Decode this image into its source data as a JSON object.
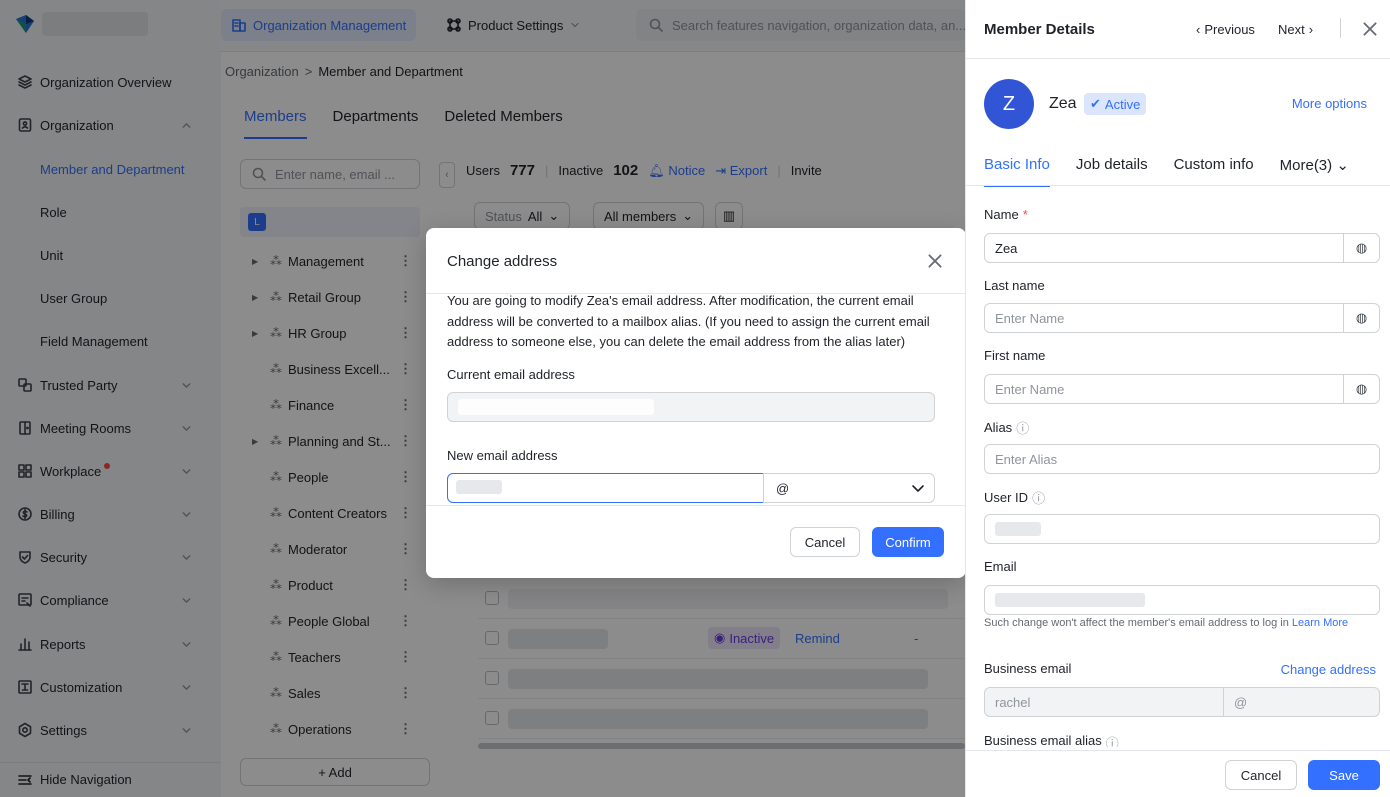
{
  "nav": {
    "items": [
      {
        "label": "Organization Overview",
        "icon": "layers-icon"
      },
      {
        "label": "Organization",
        "icon": "org-icon"
      },
      {
        "label": "Trusted Party",
        "icon": "trusted-party-icon"
      },
      {
        "label": "Meeting Rooms",
        "icon": "meeting-rooms-icon"
      },
      {
        "label": "Workplace",
        "icon": "workplace-icon"
      },
      {
        "label": "Billing",
        "icon": "billing-icon"
      },
      {
        "label": "Security",
        "icon": "shield-icon"
      },
      {
        "label": "Compliance",
        "icon": "compliance-icon"
      },
      {
        "label": "Reports",
        "icon": "reports-icon"
      },
      {
        "label": "Customization",
        "icon": "customization-icon"
      },
      {
        "label": "Settings",
        "icon": "gear-icon"
      }
    ],
    "sub_items": [
      "Member and Department",
      "Role",
      "Unit",
      "User Group",
      "Field Management"
    ],
    "hide_label": "Hide Navigation"
  },
  "topbar": {
    "org_mgmt": "Organization Management",
    "product_settings": "Product Settings",
    "search_placeholder": "Search features navigation, organization data, an..."
  },
  "breadcrumb": {
    "root": "Organization",
    "sep": ">",
    "current": "Member and Department"
  },
  "tabs": [
    "Members",
    "Departments",
    "Deleted Members"
  ],
  "tree": {
    "search_placeholder": "Enter name, email ...",
    "root_badge": "L",
    "items": [
      "Management",
      "Retail Group",
      "HR Group",
      "Business Excell...",
      "Finance",
      "Planning and St...",
      "People",
      "Content Creators",
      "Moderator",
      "Product",
      "People Global",
      "Teachers",
      "Sales",
      "Operations"
    ],
    "add_label": "+ Add"
  },
  "stats": {
    "users_label": "Users",
    "users_count": "777",
    "inactive_label": "Inactive",
    "inactive_count": "102",
    "notice": "Notice",
    "export": "Export",
    "invite": "Invite"
  },
  "filters": {
    "status_label": "Status",
    "status_value": "All",
    "members_value": "All members"
  },
  "table": {
    "inactive_badge": "Inactive",
    "remind": "Remind",
    "dash": "-"
  },
  "modal": {
    "title": "Change address",
    "description": "You are going to modify Zea's email address. After modification, the current email address will be converted to a mailbox alias. (If you need to assign the current email address to someone else, you can delete the email address from the alias later)",
    "current_label": "Current email address",
    "new_label": "New email address",
    "at": "@",
    "cancel": "Cancel",
    "confirm": "Confirm"
  },
  "panel": {
    "title": "Member Details",
    "previous": "Previous",
    "next": "Next",
    "avatar_letter": "Z",
    "name": "Zea",
    "status": "Active",
    "more_options": "More options",
    "tabs": [
      "Basic Info",
      "Job details",
      "Custom info",
      "More(3)"
    ],
    "name_label": "Name",
    "name_required": "*",
    "name_value": "Zea",
    "last_name_label": "Last name",
    "last_name_placeholder": "Enter Name",
    "first_name_label": "First name",
    "first_name_placeholder": "Enter Name",
    "alias_label": "Alias",
    "alias_placeholder": "Enter Alias",
    "user_id_label": "User ID",
    "email_label": "Email",
    "email_help": "Such change won't affect the member's email address to log in",
    "learn_more": "Learn More",
    "business_email_label": "Business email",
    "change_address": "Change address",
    "business_email_value": "rachel",
    "at": "@",
    "business_alias_label": "Business email alias",
    "cancel": "Cancel",
    "save": "Save"
  },
  "colors": {
    "accent": "#3370ff",
    "overlay": "#000000",
    "inactive": "#6a3ae0",
    "required": "#f54a45"
  }
}
